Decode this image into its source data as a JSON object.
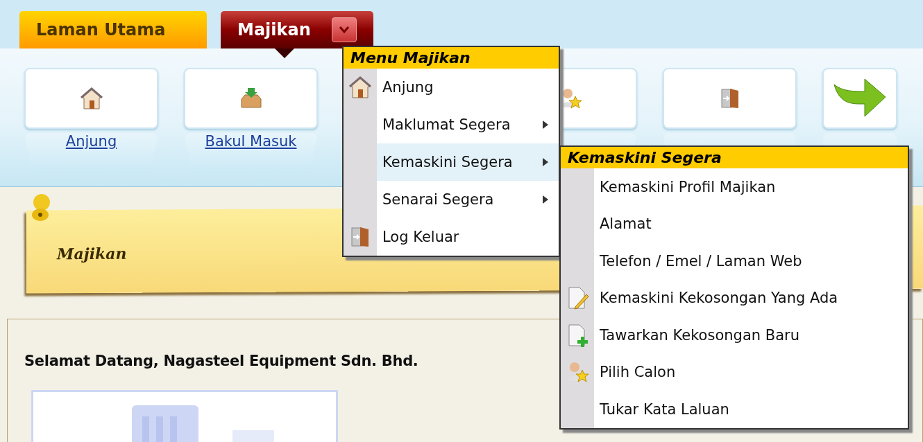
{
  "tabs": [
    {
      "label": "Laman Utama",
      "selected": false,
      "dropdown": false
    },
    {
      "label": "Majikan",
      "selected": true,
      "dropdown": true
    }
  ],
  "toolbar": [
    {
      "kind": "home",
      "label": "Anjung"
    },
    {
      "kind": "inbox",
      "label": "Bakul Masuk"
    },
    {
      "kind": "candidate"
    },
    {
      "kind": "logout"
    },
    {
      "kind": "next"
    }
  ],
  "note": {
    "title": "Majikan"
  },
  "welcome": "Selamat Datang, Nagasteel Equipment Sdn. Bhd.",
  "menu": {
    "title": "Menu Majikan",
    "items": [
      {
        "label": "Anjung",
        "kind": "home",
        "submenu": false,
        "selected": false
      },
      {
        "label": "Maklumat Segera",
        "kind": "plain",
        "submenu": true,
        "selected": false
      },
      {
        "label": "Kemaskini Segera",
        "kind": "plain",
        "submenu": true,
        "selected": true
      },
      {
        "label": "Senarai Segera",
        "kind": "plain",
        "submenu": true,
        "selected": false
      },
      {
        "label": "Log Keluar",
        "kind": "logout",
        "submenu": false,
        "selected": false
      }
    ]
  },
  "submenu": {
    "title": "Kemaskini Segera",
    "items": [
      {
        "label": "Kemaskini Profil Majikan",
        "kind": "plain"
      },
      {
        "label": "Alamat",
        "kind": "plain"
      },
      {
        "label": "Telefon / Emel / Laman Web",
        "kind": "plain"
      },
      {
        "label": "Kemaskini Kekosongan Yang Ada",
        "kind": "edit"
      },
      {
        "label": "Tawarkan Kekosongan Baru",
        "kind": "add"
      },
      {
        "label": "Pilih Calon",
        "kind": "candidate"
      },
      {
        "label": "Tukar Kata Laluan",
        "kind": "plain"
      }
    ]
  }
}
